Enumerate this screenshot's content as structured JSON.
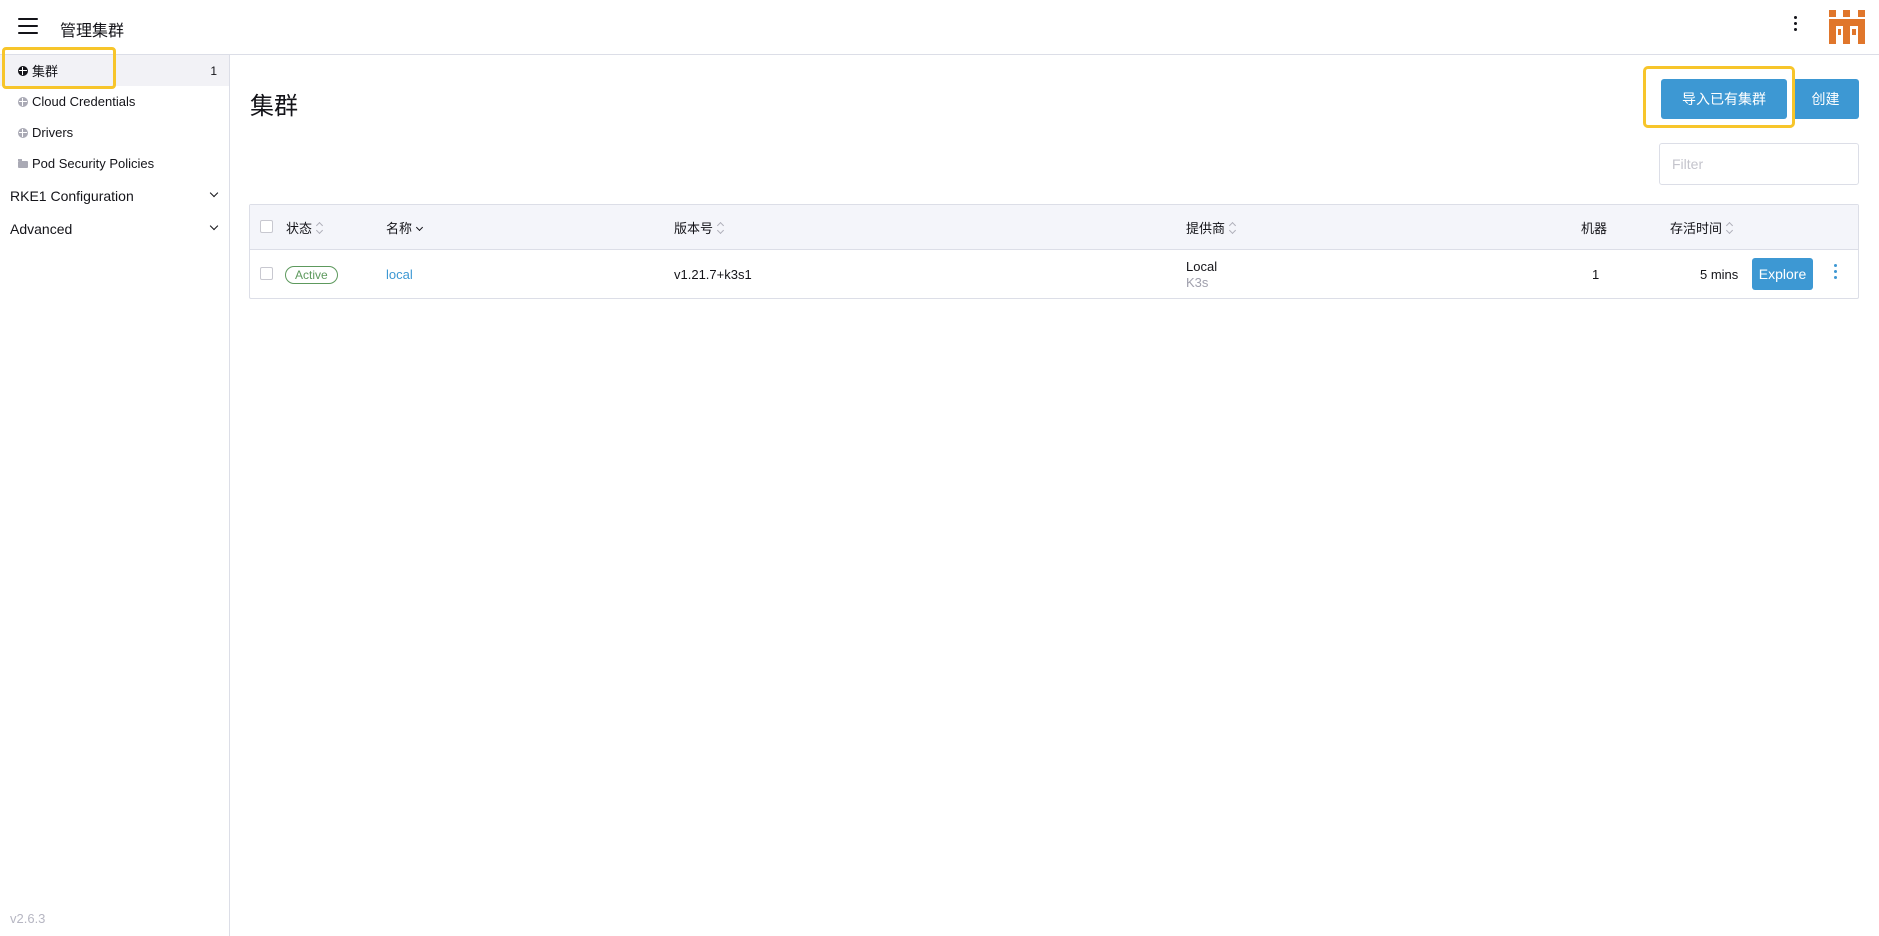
{
  "header": {
    "title": "管理集群",
    "menu_icon": "hamburger-menu-icon",
    "more_icon": "kebab-menu-icon",
    "logo_icon": "rancher-logo",
    "logo_color": "#e0762b"
  },
  "sidebar": {
    "items": [
      {
        "label": "集群",
        "icon": "globe-icon",
        "count": "1",
        "active": true
      },
      {
        "label": "Cloud Credentials",
        "icon": "globe-icon"
      },
      {
        "label": "Drivers",
        "icon": "globe-icon"
      },
      {
        "label": "Pod Security Policies",
        "icon": "folder-icon"
      }
    ],
    "groups": [
      {
        "label": "RKE1 Configuration"
      },
      {
        "label": "Advanced"
      }
    ],
    "version": "v2.6.3"
  },
  "main": {
    "title": "集群",
    "import_button": "导入已有集群",
    "create_button": "创建",
    "filter_placeholder": "Filter"
  },
  "table": {
    "columns": {
      "state": "状态",
      "name": "名称",
      "version": "版本号",
      "provider": "提供商",
      "machines": "机器",
      "age": "存活时间"
    },
    "rows": [
      {
        "state": "Active",
        "name": "local",
        "version": "v1.21.7+k3s1",
        "provider": "Local",
        "provider_sub": "K3s",
        "machines": "1",
        "age": "5 mins",
        "action": "Explore"
      }
    ]
  },
  "colors": {
    "accent": "#3d98d3",
    "highlight": "#f7c52a",
    "active_badge": "#5d995d"
  }
}
